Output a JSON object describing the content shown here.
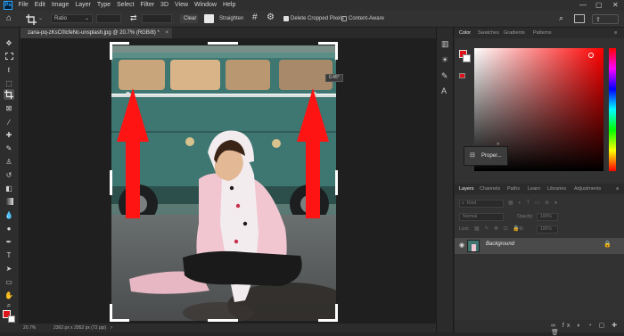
{
  "app": {
    "logo": "Ps",
    "accent": "#31a8ff"
  },
  "menubar": {
    "items": [
      "File",
      "Edit",
      "Image",
      "Layer",
      "Type",
      "Select",
      "Filter",
      "3D",
      "View",
      "Window",
      "Help"
    ],
    "window_controls": [
      "minimize-icon",
      "maximize-icon",
      "close-icon"
    ]
  },
  "options": {
    "ratio_value": "Ratio",
    "clear_label": "Clear",
    "straighten_label": "Straighten",
    "delete_cropped_label": "Delete Cropped Pixels",
    "delete_cropped_checked": true,
    "content_aware_label": "Content-Aware",
    "content_aware_checked": false
  },
  "document": {
    "tab_title": "zana-pq-zKsC0lcfeNc-unsplash.jpg @ 20.7% (RGB/8) *",
    "zoom": "20.7%",
    "size_info": "2362 px x 2952 px (72 ppi)",
    "angle_readout": "0.45°"
  },
  "annotations": {
    "arrow_color": "#ff1414"
  },
  "color_panel": {
    "tabs": [
      "Color",
      "Swatches",
      "Gradients",
      "Patterns"
    ],
    "active_tab": "Color",
    "foreground": "#e0121a",
    "background": "#ffffff"
  },
  "properties_popup": {
    "label": "Proper..."
  },
  "layers_panel": {
    "tabs": [
      "Layers",
      "Channels",
      "Paths",
      "Learn",
      "Libraries",
      "Adjustments"
    ],
    "active_tab": "Layers",
    "search_placeholder": "Kind",
    "blend_mode": "Normal",
    "opacity_label": "Opacity:",
    "opacity_value": "100%",
    "lock_label": "Lock:",
    "fill_label": "Fill:",
    "fill_value": "100%",
    "layers": [
      {
        "name": "Background",
        "visible": true,
        "locked": true
      }
    ]
  }
}
